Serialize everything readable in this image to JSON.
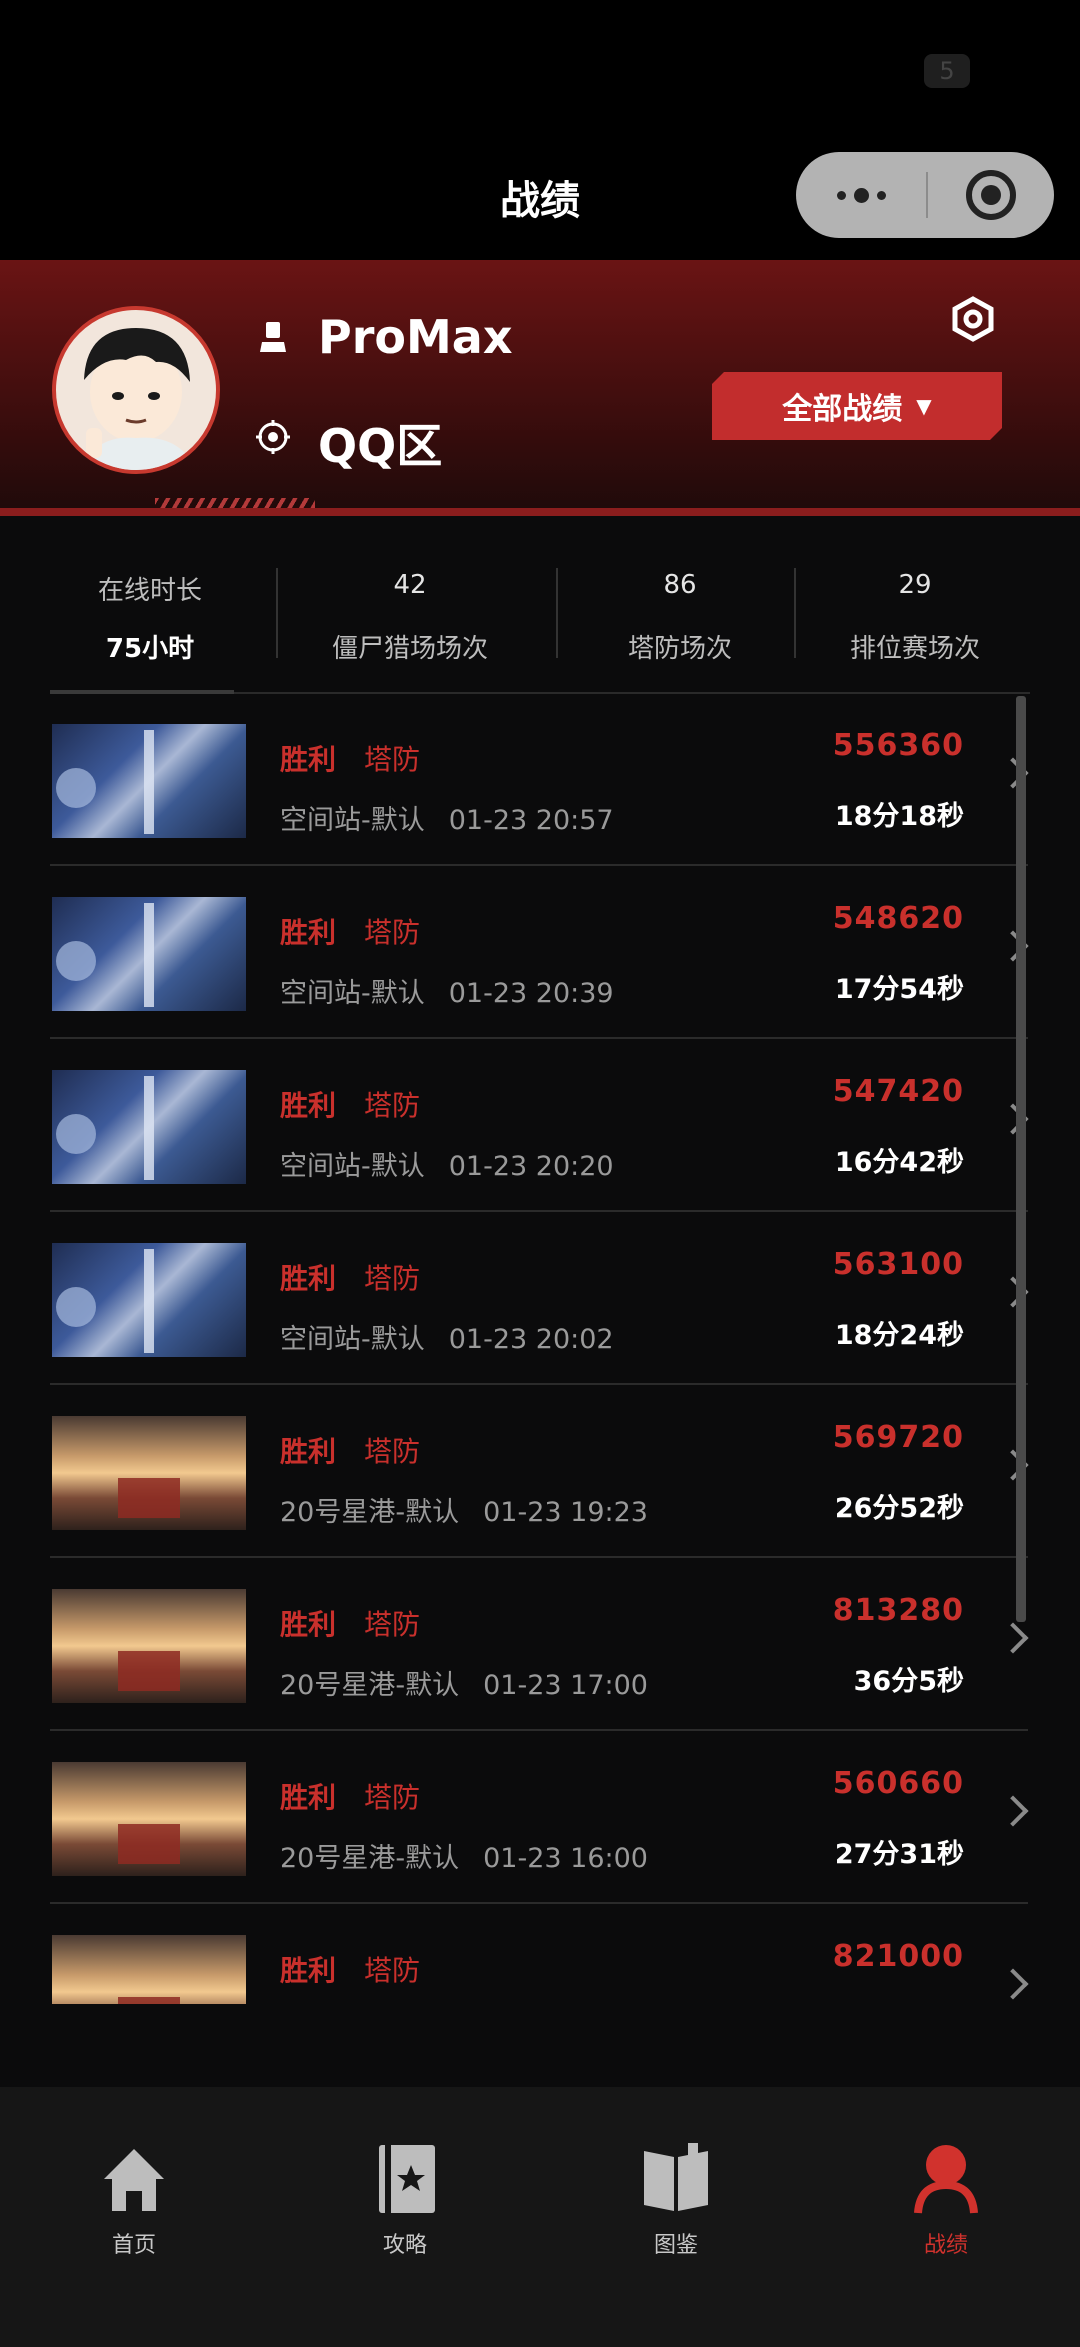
{
  "status_bar": {
    "battery": "5"
  },
  "nav": {
    "title": "战绩"
  },
  "profile": {
    "username": "ProMax",
    "zone": "QQ区",
    "filter_button": "全部战绩",
    "filter_caret": "▼"
  },
  "stats": [
    {
      "top": "在线时长",
      "bottom": "75小时"
    },
    {
      "top": "42",
      "bottom": "僵尸猎场场次"
    },
    {
      "top": "86",
      "bottom": "塔防场次"
    },
    {
      "top": "29",
      "bottom": "排位赛场次"
    }
  ],
  "records": [
    {
      "result": "胜利",
      "mode": "塔防",
      "map": "空间站-默认",
      "time": "01-23 20:57",
      "score": "556360",
      "duration": "18分18秒",
      "thumb": "space-station"
    },
    {
      "result": "胜利",
      "mode": "塔防",
      "map": "空间站-默认",
      "time": "01-23 20:39",
      "score": "548620",
      "duration": "17分54秒",
      "thumb": "space-station"
    },
    {
      "result": "胜利",
      "mode": "塔防",
      "map": "空间站-默认",
      "time": "01-23 20:20",
      "score": "547420",
      "duration": "16分42秒",
      "thumb": "space-station"
    },
    {
      "result": "胜利",
      "mode": "塔防",
      "map": "空间站-默认",
      "time": "01-23 20:02",
      "score": "563100",
      "duration": "18分24秒",
      "thumb": "space-station"
    },
    {
      "result": "胜利",
      "mode": "塔防",
      "map": "20号星港-默认",
      "time": "01-23 19:23",
      "score": "569720",
      "duration": "26分52秒",
      "thumb": "star-port"
    },
    {
      "result": "胜利",
      "mode": "塔防",
      "map": "20号星港-默认",
      "time": "01-23 17:00",
      "score": "813280",
      "duration": "36分5秒",
      "thumb": "star-port"
    },
    {
      "result": "胜利",
      "mode": "塔防",
      "map": "20号星港-默认",
      "time": "01-23 16:00",
      "score": "560660",
      "duration": "27分31秒",
      "thumb": "star-port"
    },
    {
      "result": "胜利",
      "mode": "塔防",
      "map": "",
      "time": "",
      "score": "821000",
      "duration": "",
      "thumb": "star-port"
    }
  ],
  "tabs": [
    {
      "label": "首页",
      "icon": "home-icon",
      "active": false
    },
    {
      "label": "攻略",
      "icon": "guide-book-icon",
      "active": false
    },
    {
      "label": "图鉴",
      "icon": "open-book-icon",
      "active": false
    },
    {
      "label": "战绩",
      "icon": "person-icon",
      "active": true
    }
  ],
  "colors": {
    "accent": "#c9302c",
    "background": "#0b0b0c",
    "header_red": "#6a1414"
  }
}
